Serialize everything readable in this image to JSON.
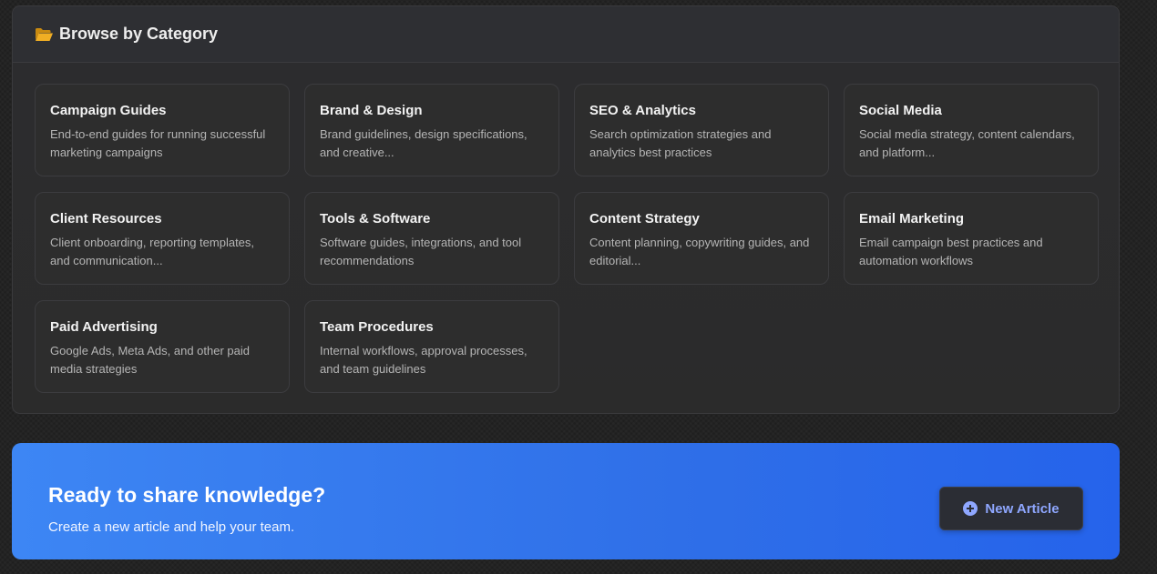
{
  "browse": {
    "title": "Browse by Category",
    "icon": "folder-open-icon",
    "icon_color": "#e6a21a",
    "categories": [
      {
        "title": "Campaign Guides",
        "description": "End-to-end guides for running successful marketing campaigns"
      },
      {
        "title": "Brand & Design",
        "description": "Brand guidelines, design specifications, and creative..."
      },
      {
        "title": "SEO & Analytics",
        "description": "Search optimization strategies and analytics best practices"
      },
      {
        "title": "Social Media",
        "description": "Social media strategy, content calendars, and platform..."
      },
      {
        "title": "Client Resources",
        "description": "Client onboarding, reporting templates, and communication..."
      },
      {
        "title": "Tools & Software",
        "description": "Software guides, integrations, and tool recommendations"
      },
      {
        "title": "Content Strategy",
        "description": "Content planning, copywriting guides, and editorial..."
      },
      {
        "title": "Email Marketing",
        "description": "Email campaign best practices and automation workflows"
      },
      {
        "title": "Paid Advertising",
        "description": "Google Ads, Meta Ads, and other paid media strategies"
      },
      {
        "title": "Team Procedures",
        "description": "Internal workflows, approval processes, and team guidelines"
      }
    ]
  },
  "cta": {
    "title": "Ready to share knowledge?",
    "subtitle": "Create a new article and help your team.",
    "button_label": "New Article",
    "button_icon": "plus-circle-icon",
    "accent": "#2f6fe8",
    "button_text_color": "#8fa7ff"
  }
}
